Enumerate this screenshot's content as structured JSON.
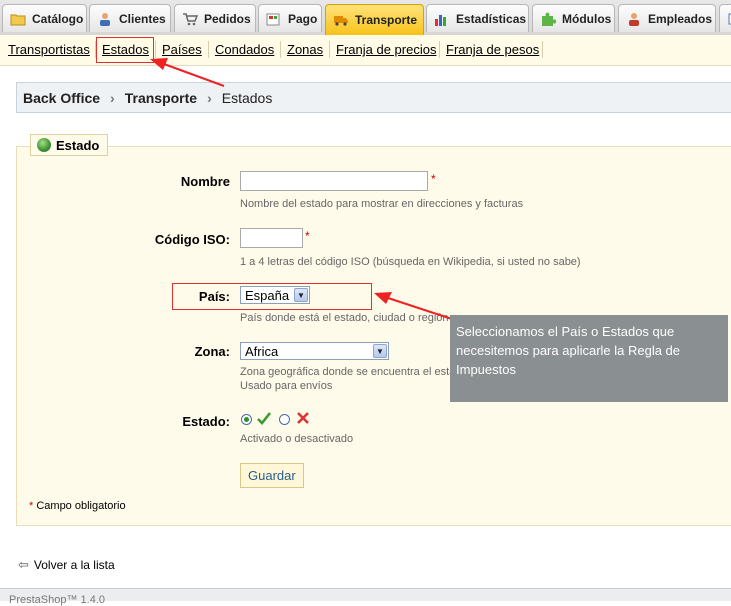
{
  "tabs": [
    {
      "label": "Catálogo",
      "icon": "folder-icon",
      "active": false
    },
    {
      "label": "Clientes",
      "icon": "customer-icon",
      "active": false
    },
    {
      "label": "Pedidos",
      "icon": "cart-icon",
      "active": false
    },
    {
      "label": "Pago",
      "icon": "payment-icon",
      "active": false
    },
    {
      "label": "Transporte",
      "icon": "truck-icon",
      "active": true
    },
    {
      "label": "Estadísticas",
      "icon": "chart-icon",
      "active": false
    },
    {
      "label": "Módulos",
      "icon": "puzzle-icon",
      "active": false
    },
    {
      "label": "Empleados",
      "icon": "employee-icon",
      "active": false
    }
  ],
  "subnav": [
    "Transportistas",
    "Estados",
    "Países",
    "Condados",
    "Zonas",
    "Franja de precios",
    "Franja de pesos"
  ],
  "breadcrumb": {
    "root": "Back Office",
    "section": "Transporte",
    "page": "Estados"
  },
  "form": {
    "legend": "Estado",
    "nombre": {
      "label": "Nombre",
      "value": "",
      "hint": "Nombre del estado para mostrar en direcciones y facturas"
    },
    "iso": {
      "label": "Código ISO:",
      "value": "",
      "hint": "1 a 4 letras del código ISO (búsqueda en Wikipedia, si usted no sabe)"
    },
    "pais": {
      "label": "País:",
      "value": "España",
      "hint": "País donde está el estado, ciudad o región"
    },
    "zona": {
      "label": "Zona:",
      "value": "Africa",
      "hint1": "Zona geográfica donde se encuentra el estado",
      "hint2": "Usado para envíos"
    },
    "estado": {
      "label": "Estado:",
      "active": true,
      "hint": "Activado o desactivado"
    },
    "save_label": "Guardar",
    "required_mark": "*",
    "required_note": "Campo obligatorio"
  },
  "callout": "Seleccionamos el País o Estados que necesitemos para aplicarle la Regla de Impuestos",
  "back_label": "Volver a la lista",
  "footer": "PrestaShop™ 1.4.0",
  "colors": {
    "active_tab": "#f7c21a",
    "annotation_red": "#e03030",
    "callout_bg": "#8a8f91",
    "panel_bg": "#fffbea"
  }
}
